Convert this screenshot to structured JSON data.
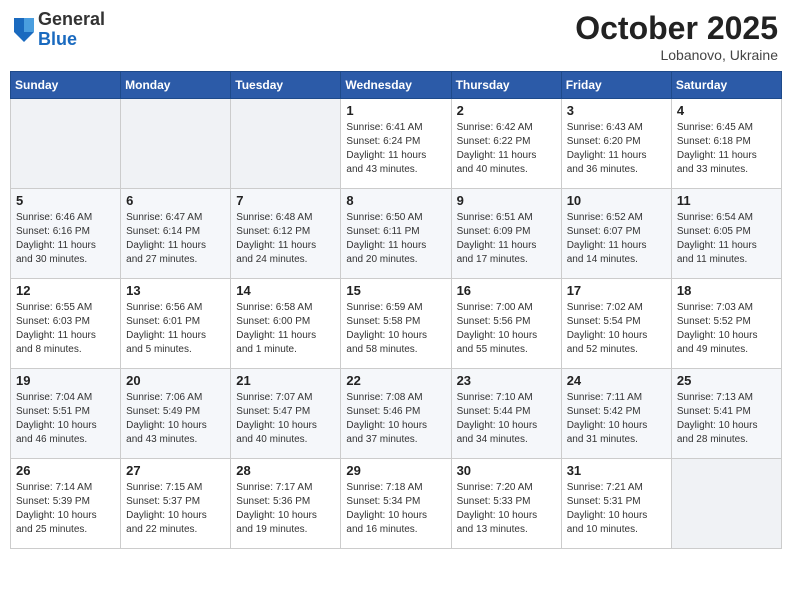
{
  "header": {
    "logo": {
      "general": "General",
      "blue": "Blue"
    },
    "title": "October 2025",
    "location": "Lobanovo, Ukraine"
  },
  "weekdays": [
    "Sunday",
    "Monday",
    "Tuesday",
    "Wednesday",
    "Thursday",
    "Friday",
    "Saturday"
  ],
  "weeks": [
    [
      {
        "day": "",
        "sunrise": "",
        "sunset": "",
        "daylight": ""
      },
      {
        "day": "",
        "sunrise": "",
        "sunset": "",
        "daylight": ""
      },
      {
        "day": "",
        "sunrise": "",
        "sunset": "",
        "daylight": ""
      },
      {
        "day": "1",
        "sunrise": "Sunrise: 6:41 AM",
        "sunset": "Sunset: 6:24 PM",
        "daylight": "Daylight: 11 hours and 43 minutes."
      },
      {
        "day": "2",
        "sunrise": "Sunrise: 6:42 AM",
        "sunset": "Sunset: 6:22 PM",
        "daylight": "Daylight: 11 hours and 40 minutes."
      },
      {
        "day": "3",
        "sunrise": "Sunrise: 6:43 AM",
        "sunset": "Sunset: 6:20 PM",
        "daylight": "Daylight: 11 hours and 36 minutes."
      },
      {
        "day": "4",
        "sunrise": "Sunrise: 6:45 AM",
        "sunset": "Sunset: 6:18 PM",
        "daylight": "Daylight: 11 hours and 33 minutes."
      }
    ],
    [
      {
        "day": "5",
        "sunrise": "Sunrise: 6:46 AM",
        "sunset": "Sunset: 6:16 PM",
        "daylight": "Daylight: 11 hours and 30 minutes."
      },
      {
        "day": "6",
        "sunrise": "Sunrise: 6:47 AM",
        "sunset": "Sunset: 6:14 PM",
        "daylight": "Daylight: 11 hours and 27 minutes."
      },
      {
        "day": "7",
        "sunrise": "Sunrise: 6:48 AM",
        "sunset": "Sunset: 6:12 PM",
        "daylight": "Daylight: 11 hours and 24 minutes."
      },
      {
        "day": "8",
        "sunrise": "Sunrise: 6:50 AM",
        "sunset": "Sunset: 6:11 PM",
        "daylight": "Daylight: 11 hours and 20 minutes."
      },
      {
        "day": "9",
        "sunrise": "Sunrise: 6:51 AM",
        "sunset": "Sunset: 6:09 PM",
        "daylight": "Daylight: 11 hours and 17 minutes."
      },
      {
        "day": "10",
        "sunrise": "Sunrise: 6:52 AM",
        "sunset": "Sunset: 6:07 PM",
        "daylight": "Daylight: 11 hours and 14 minutes."
      },
      {
        "day": "11",
        "sunrise": "Sunrise: 6:54 AM",
        "sunset": "Sunset: 6:05 PM",
        "daylight": "Daylight: 11 hours and 11 minutes."
      }
    ],
    [
      {
        "day": "12",
        "sunrise": "Sunrise: 6:55 AM",
        "sunset": "Sunset: 6:03 PM",
        "daylight": "Daylight: 11 hours and 8 minutes."
      },
      {
        "day": "13",
        "sunrise": "Sunrise: 6:56 AM",
        "sunset": "Sunset: 6:01 PM",
        "daylight": "Daylight: 11 hours and 5 minutes."
      },
      {
        "day": "14",
        "sunrise": "Sunrise: 6:58 AM",
        "sunset": "Sunset: 6:00 PM",
        "daylight": "Daylight: 11 hours and 1 minute."
      },
      {
        "day": "15",
        "sunrise": "Sunrise: 6:59 AM",
        "sunset": "Sunset: 5:58 PM",
        "daylight": "Daylight: 10 hours and 58 minutes."
      },
      {
        "day": "16",
        "sunrise": "Sunrise: 7:00 AM",
        "sunset": "Sunset: 5:56 PM",
        "daylight": "Daylight: 10 hours and 55 minutes."
      },
      {
        "day": "17",
        "sunrise": "Sunrise: 7:02 AM",
        "sunset": "Sunset: 5:54 PM",
        "daylight": "Daylight: 10 hours and 52 minutes."
      },
      {
        "day": "18",
        "sunrise": "Sunrise: 7:03 AM",
        "sunset": "Sunset: 5:52 PM",
        "daylight": "Daylight: 10 hours and 49 minutes."
      }
    ],
    [
      {
        "day": "19",
        "sunrise": "Sunrise: 7:04 AM",
        "sunset": "Sunset: 5:51 PM",
        "daylight": "Daylight: 10 hours and 46 minutes."
      },
      {
        "day": "20",
        "sunrise": "Sunrise: 7:06 AM",
        "sunset": "Sunset: 5:49 PM",
        "daylight": "Daylight: 10 hours and 43 minutes."
      },
      {
        "day": "21",
        "sunrise": "Sunrise: 7:07 AM",
        "sunset": "Sunset: 5:47 PM",
        "daylight": "Daylight: 10 hours and 40 minutes."
      },
      {
        "day": "22",
        "sunrise": "Sunrise: 7:08 AM",
        "sunset": "Sunset: 5:46 PM",
        "daylight": "Daylight: 10 hours and 37 minutes."
      },
      {
        "day": "23",
        "sunrise": "Sunrise: 7:10 AM",
        "sunset": "Sunset: 5:44 PM",
        "daylight": "Daylight: 10 hours and 34 minutes."
      },
      {
        "day": "24",
        "sunrise": "Sunrise: 7:11 AM",
        "sunset": "Sunset: 5:42 PM",
        "daylight": "Daylight: 10 hours and 31 minutes."
      },
      {
        "day": "25",
        "sunrise": "Sunrise: 7:13 AM",
        "sunset": "Sunset: 5:41 PM",
        "daylight": "Daylight: 10 hours and 28 minutes."
      }
    ],
    [
      {
        "day": "26",
        "sunrise": "Sunrise: 7:14 AM",
        "sunset": "Sunset: 5:39 PM",
        "daylight": "Daylight: 10 hours and 25 minutes."
      },
      {
        "day": "27",
        "sunrise": "Sunrise: 7:15 AM",
        "sunset": "Sunset: 5:37 PM",
        "daylight": "Daylight: 10 hours and 22 minutes."
      },
      {
        "day": "28",
        "sunrise": "Sunrise: 7:17 AM",
        "sunset": "Sunset: 5:36 PM",
        "daylight": "Daylight: 10 hours and 19 minutes."
      },
      {
        "day": "29",
        "sunrise": "Sunrise: 7:18 AM",
        "sunset": "Sunset: 5:34 PM",
        "daylight": "Daylight: 10 hours and 16 minutes."
      },
      {
        "day": "30",
        "sunrise": "Sunrise: 7:20 AM",
        "sunset": "Sunset: 5:33 PM",
        "daylight": "Daylight: 10 hours and 13 minutes."
      },
      {
        "day": "31",
        "sunrise": "Sunrise: 7:21 AM",
        "sunset": "Sunset: 5:31 PM",
        "daylight": "Daylight: 10 hours and 10 minutes."
      },
      {
        "day": "",
        "sunrise": "",
        "sunset": "",
        "daylight": ""
      }
    ]
  ]
}
